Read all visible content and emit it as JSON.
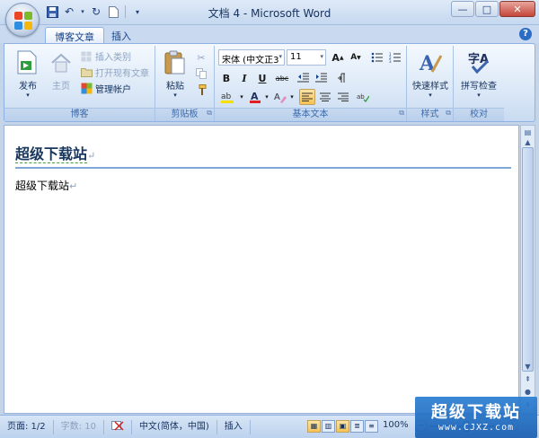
{
  "window": {
    "title": "文档 4 - Microsoft Word",
    "minimize": "—",
    "maximize": "□",
    "close": "✕"
  },
  "tabs": [
    {
      "label": "博客文章",
      "active": true
    },
    {
      "label": "插入",
      "active": false
    }
  ],
  "help_label": "?",
  "ribbon": {
    "blog": {
      "label": "博客",
      "publish": "发布",
      "home": "主页",
      "insert_category": "插入类别",
      "open_existing": "打开现有文章",
      "manage_accounts": "管理帐户"
    },
    "clipboard": {
      "label": "剪贴板",
      "paste": "粘贴"
    },
    "basic_text": {
      "label": "基本文本",
      "font": "宋体 (中文正3",
      "size": "11",
      "bold": "B",
      "italic": "I",
      "underline": "U",
      "strike": "abc"
    },
    "styles": {
      "label": "样式",
      "quick_styles": "快速样式"
    },
    "proofing": {
      "label": "校对",
      "spell_check": "拼写检查"
    }
  },
  "document": {
    "heading": "超级下载站",
    "body": "超级下载站",
    "pilcrow": "↵"
  },
  "status": {
    "page": "页面: 1/2",
    "words": "字数: 10",
    "language": "中文(简体，中国)",
    "mode": "插入",
    "zoom": "100%"
  },
  "watermark": {
    "line1": "超级下载站",
    "line2": "www.CJXZ.com"
  },
  "colors": {
    "accent": "#15428b",
    "ribbon_border": "#8db2e3",
    "highlight": "#f8c252",
    "font_color_bar": "#e02020",
    "highlight_bar": "#f7e000"
  }
}
